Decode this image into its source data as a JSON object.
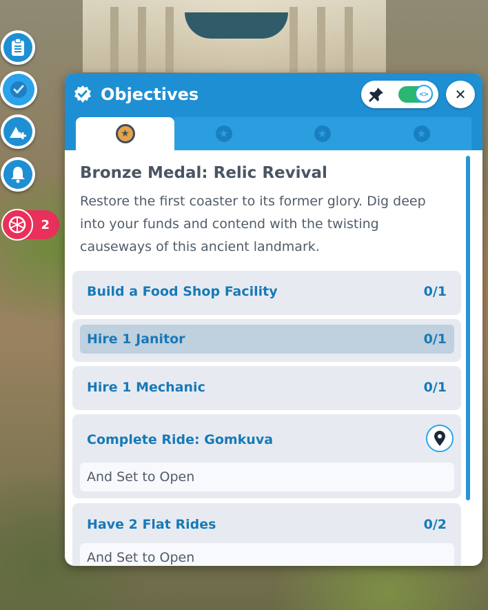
{
  "hud": {
    "buttons": [
      {
        "name": "clipboard-icon"
      },
      {
        "name": "objectives-check-icon"
      },
      {
        "name": "terrain-add-icon"
      },
      {
        "name": "bell-icon"
      }
    ],
    "alert_count": "2"
  },
  "panel": {
    "title": "Objectives",
    "pin_icon": "pin-icon",
    "toggle_glyph": "<>",
    "pinned": true,
    "close_label": "✕",
    "tabs": [
      {
        "name": "bronze-medal",
        "active": true,
        "glyph": "★"
      },
      {
        "name": "silver-medal",
        "active": false,
        "glyph": "★"
      },
      {
        "name": "gold-medal",
        "active": false,
        "glyph": "★"
      },
      {
        "name": "platinum-medal",
        "active": false,
        "glyph": "★"
      }
    ],
    "medal_title": "Bronze Medal: Relic Revival",
    "description": "Restore the first coaster to its former glory. Dig deep into your funds and contend with the twisting causeways of this ancient landmark.",
    "objectives": [
      {
        "label": "Build a Food Shop Facility",
        "count": "0/1"
      },
      {
        "label": "Hire 1 Janitor",
        "count": "0/1"
      },
      {
        "label": "Hire 1 Mechanic",
        "count": "0/1"
      },
      {
        "label": "Complete Ride: Gomkuva",
        "sub": "And Set to Open"
      },
      {
        "label": "Have 2 Flat Rides",
        "count": "0/2",
        "sub": "And Set to Open"
      }
    ]
  },
  "colors": {
    "header": "#1f8fd3",
    "objective_text": "#1779b8",
    "alert": "#e8305b",
    "toggle_on": "#2bb673"
  }
}
